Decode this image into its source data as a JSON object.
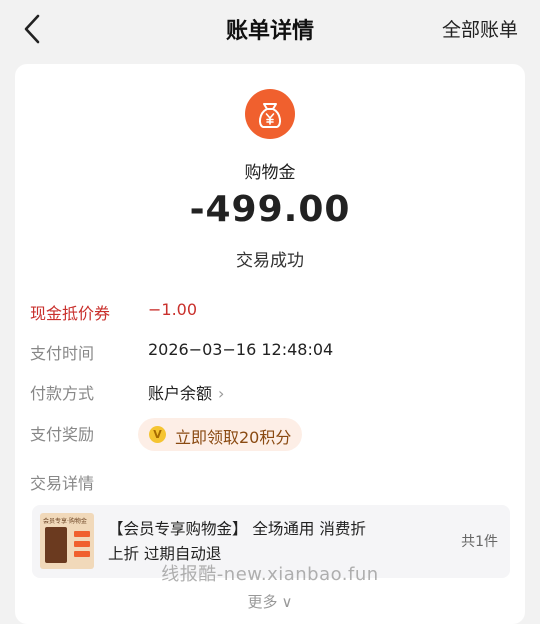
{
  "nav": {
    "title": "账单详情",
    "right_link": "全部账单"
  },
  "summary": {
    "icon": "money-bag-yen-icon",
    "asset_name": "购物金",
    "amount": "-499.00",
    "status": "交易成功",
    "accent_color": "#f0602e"
  },
  "details": {
    "coupon_label": "现金抵价券",
    "coupon_value": "−1.00",
    "time_label": "支付时间",
    "time_value": "2026−03−16 12:48:04",
    "method_label": "付款方式",
    "method_value": "账户余额",
    "reward_label": "支付奖励",
    "reward_button": "立即领取20积分",
    "reward_icon_text": "V",
    "trade_label": "交易详情"
  },
  "goods": {
    "title": "【会员专享购物金】 全场通用 消费折上折 过期自动退",
    "count": "共1件",
    "thumb_caption": "会员专享·购物金"
  },
  "footer": {
    "watermark": "线报酷-new.xianbao.fun",
    "more": "更多"
  }
}
